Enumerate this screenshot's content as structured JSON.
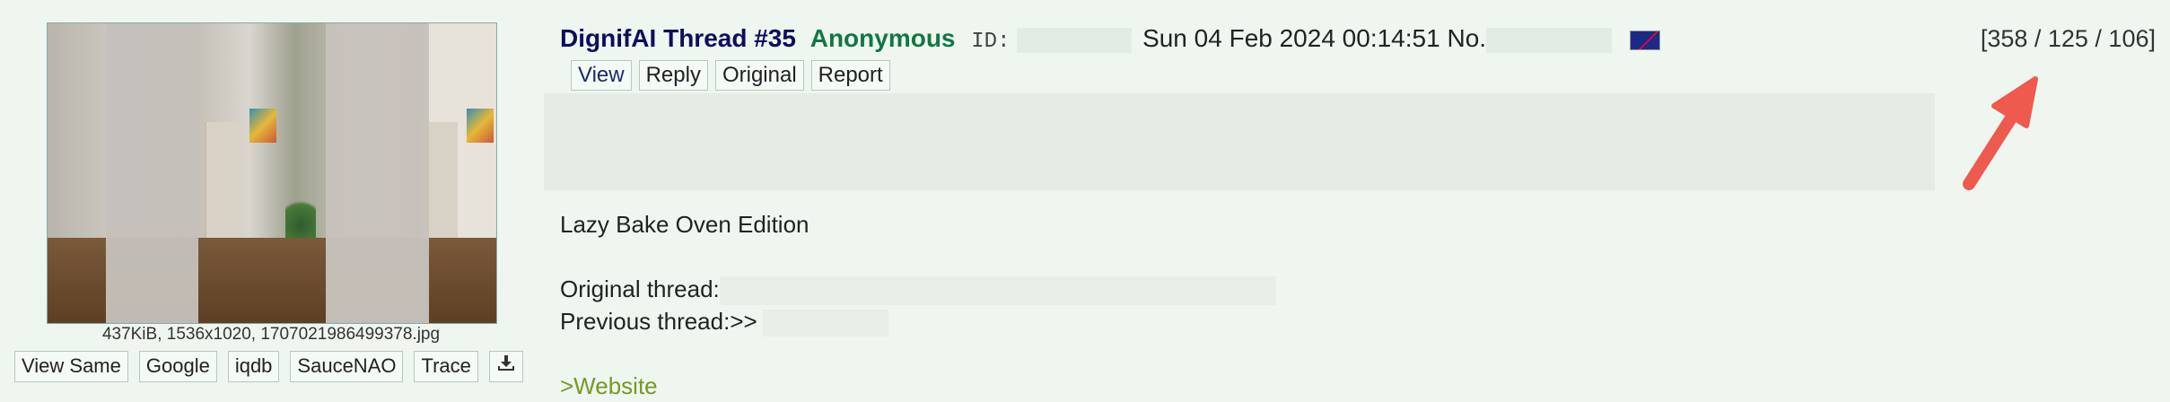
{
  "post": {
    "subject": "DignifAI Thread #35",
    "name": "Anonymous",
    "id_label": "ID:",
    "datetime": "Sun 04 Feb 2024 00:14:51",
    "number_label": "No.",
    "flag_icon": "australia-flag-icon",
    "actions": {
      "view": "View",
      "reply": "Reply",
      "original": "Original",
      "report": "Report"
    },
    "body": {
      "line1": "Lazy Bake Oven Edition",
      "line2": "Original thread:",
      "line3": "Previous thread:>>",
      "line4": ">Website"
    }
  },
  "file": {
    "info": "437KiB, 1536x1020, 1707021986499378.jpg",
    "links": {
      "view_same": "View Same",
      "google": "Google",
      "iqdb": "iqdb",
      "saucenao": "SauceNAO",
      "trace": "Trace"
    },
    "download_icon": "download-icon"
  },
  "thread_counts": "[358 / 125 / 106]",
  "colors": {
    "background": "#eef6ef",
    "subject": "#0f0c5d",
    "name": "#117743",
    "greentext": "#789922",
    "arrow": "#ee5a4e"
  }
}
